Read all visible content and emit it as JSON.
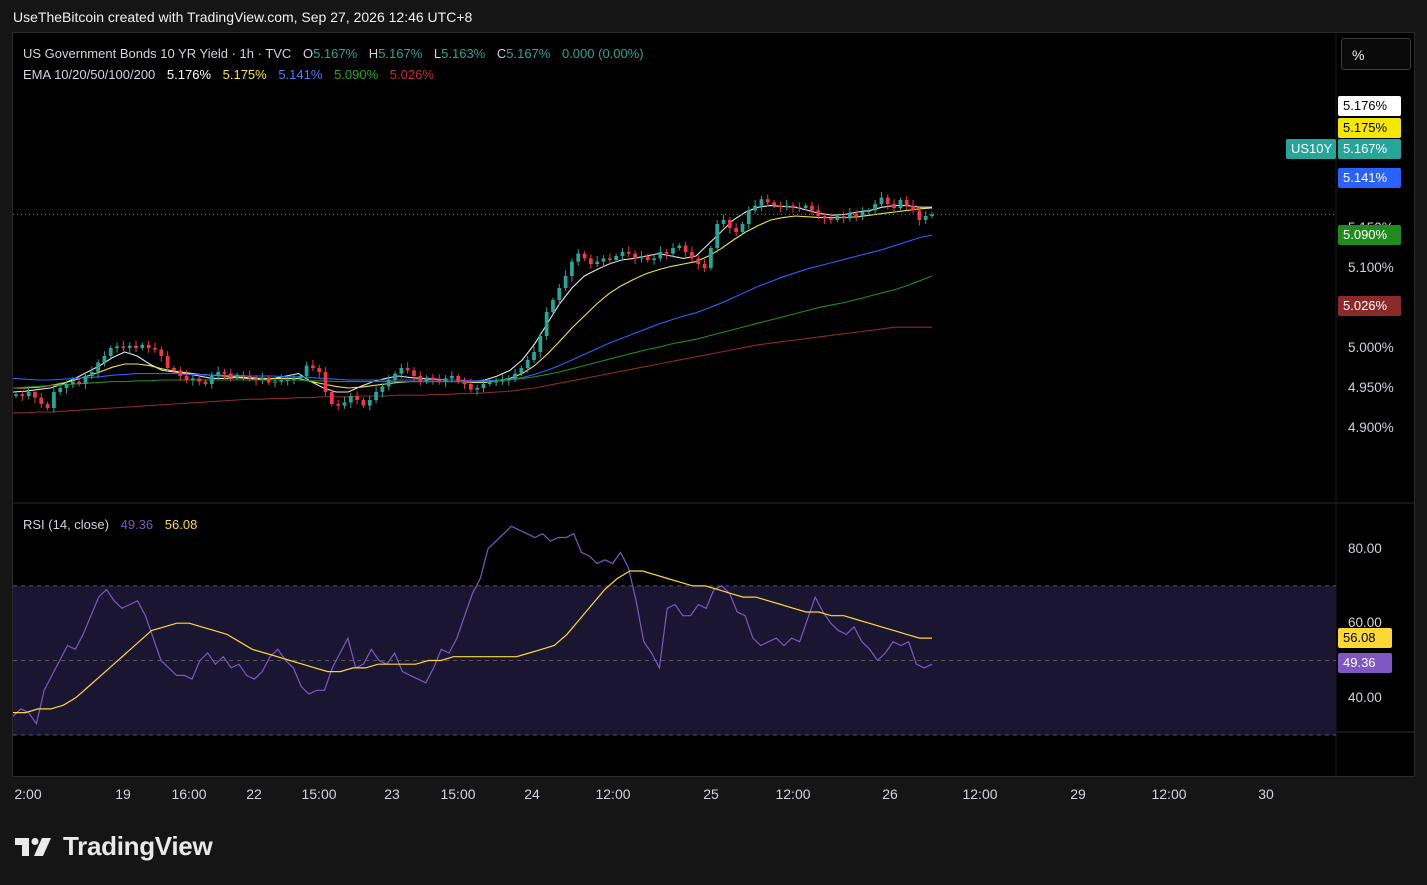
{
  "caption": "UseTheBitcoin created with TradingView.com, Sep 27, 2026 12:46 UTC+8",
  "legend": {
    "title": "US Government Bonds 10 YR Yield · 1h · TVC",
    "o_label": "O",
    "o_value": "5.167%",
    "h_label": "H",
    "h_value": "5.167%",
    "l_label": "L",
    "l_value": "5.163%",
    "c_label": "C",
    "c_value": "5.167%",
    "change": "0.000 (0.00%)",
    "ema_label": "EMA 10/20/50/100/200",
    "ema10": "5.176%",
    "ema20": "5.175%",
    "ema50": "5.141%",
    "ema100": "5.090%",
    "ema200": "5.026%"
  },
  "rsi_legend": {
    "label": "RSI (14, close)",
    "rsi": "49.36",
    "ma": "56.08"
  },
  "toolbar": {
    "percent_label": "%"
  },
  "symbol_tag": "US10Y",
  "brand": {
    "name": "TradingView",
    "icon": "tradingview-logo-icon"
  },
  "colors": {
    "up": "#26a69a",
    "down": "#f23645",
    "ema10": "#e6e6e6",
    "ema20": "#f5e342",
    "ema50": "#2962ff",
    "ema100": "#1e8c1e",
    "ema200": "#8b2a2a",
    "rsi": "#7e57c2",
    "rsi_ma": "#fdd835"
  },
  "chart_data": [
    {
      "type": "candlestick",
      "title": "US Government Bonds 10 YR Yield · 1h · TVC",
      "x_ticks": [
        "2:00",
        "19",
        "16:00",
        "22",
        "15:00",
        "23",
        "15:00",
        "24",
        "12:00",
        "25",
        "12:00",
        "26",
        "12:00",
        "29",
        "12:00",
        "30"
      ],
      "y_ticks": [
        "4.900%",
        "4.950%",
        "5.000%",
        "5.050%",
        "5.100%",
        "5.150%"
      ],
      "ylim": [
        4.875,
        5.25
      ],
      "last_close": "5.167%",
      "ema_labels": [
        "5.176%",
        "5.175%",
        "5.141%",
        "5.090%",
        "5.026%"
      ],
      "close": [
        4.942,
        4.94,
        4.945,
        4.938,
        4.93,
        4.925,
        4.945,
        4.95,
        4.955,
        4.958,
        4.955,
        4.965,
        4.97,
        4.982,
        4.99,
        5.0,
        5.002,
        5.0,
        5.003,
        5.0,
        5.004,
        5.0,
        4.998,
        4.99,
        4.975,
        4.972,
        4.965,
        4.96,
        4.962,
        4.958,
        4.955,
        4.965,
        4.97,
        4.968,
        4.963,
        4.966,
        4.965,
        4.962,
        4.96,
        4.963,
        4.957,
        4.958,
        4.96,
        4.96,
        4.962,
        4.965,
        4.978,
        4.975,
        4.97,
        4.945,
        4.93,
        4.928,
        4.932,
        4.94,
        4.935,
        4.928,
        4.935,
        4.945,
        4.952,
        4.96,
        4.968,
        4.975,
        4.972,
        4.965,
        4.958,
        4.963,
        4.96,
        4.958,
        4.962,
        4.965,
        4.958,
        4.955,
        4.948,
        4.95,
        4.955,
        4.958,
        4.958,
        4.96,
        4.962,
        4.968,
        4.975,
        4.985,
        4.995,
        5.015,
        5.045,
        5.06,
        5.075,
        5.09,
        5.108,
        5.118,
        5.112,
        5.105,
        5.108,
        5.112,
        5.11,
        5.115,
        5.12,
        5.118,
        5.112,
        5.115,
        5.11,
        5.112,
        5.12,
        5.118,
        5.125,
        5.128,
        5.12,
        5.112,
        5.105,
        5.1,
        5.125,
        5.155,
        5.16,
        5.15,
        5.145,
        5.155,
        5.172,
        5.178,
        5.186,
        5.182,
        5.178,
        5.176,
        5.178,
        5.176,
        5.175,
        5.178,
        5.172,
        5.165,
        5.162,
        5.16,
        5.165,
        5.162,
        5.168,
        5.165,
        5.17,
        5.172,
        5.18,
        5.188,
        5.18,
        5.175,
        5.185,
        5.178,
        5.172,
        5.16,
        5.165,
        5.167
      ],
      "ema_series": [
        {
          "name": "EMA 10",
          "values": [
            4.945,
            4.946,
            4.948,
            4.95,
            4.955,
            4.962,
            4.97,
            4.978,
            4.988,
            4.995,
            4.99,
            4.98,
            4.972,
            4.97,
            4.968,
            4.965,
            4.962,
            4.962,
            4.963,
            4.962,
            4.961,
            4.962,
            4.965,
            4.968,
            4.958,
            4.95,
            4.945,
            4.945,
            4.952,
            4.958,
            4.962,
            4.965,
            4.963,
            4.962,
            4.961,
            4.96,
            4.96,
            4.958,
            4.96,
            4.965,
            4.972,
            4.985,
            5.005,
            5.03,
            5.055,
            5.075,
            5.09,
            5.098,
            5.105,
            5.11,
            5.112,
            5.115,
            5.118,
            5.115,
            5.112,
            5.115,
            5.13,
            5.145,
            5.16,
            5.17,
            5.176,
            5.178,
            5.177,
            5.176,
            5.172,
            5.168,
            5.166,
            5.167,
            5.17,
            5.172,
            5.176,
            5.178,
            5.178,
            5.176,
            5.176
          ]
        },
        {
          "name": "EMA 20",
          "values": [
            4.95,
            4.95,
            4.951,
            4.953,
            4.956,
            4.96,
            4.965,
            4.97,
            4.976,
            4.98,
            4.98,
            4.978,
            4.974,
            4.971,
            4.969,
            4.967,
            4.966,
            4.965,
            4.964,
            4.963,
            4.962,
            4.962,
            4.962,
            4.962,
            4.958,
            4.955,
            4.952,
            4.95,
            4.951,
            4.953,
            4.955,
            4.957,
            4.958,
            4.958,
            4.958,
            4.958,
            4.958,
            4.957,
            4.957,
            4.959,
            4.962,
            4.968,
            4.978,
            4.992,
            5.008,
            5.025,
            5.04,
            5.055,
            5.068,
            5.078,
            5.086,
            5.093,
            5.098,
            5.102,
            5.105,
            5.108,
            5.115,
            5.124,
            5.135,
            5.145,
            5.153,
            5.16,
            5.163,
            5.165,
            5.164,
            5.163,
            5.163,
            5.163,
            5.164,
            5.166,
            5.168,
            5.17,
            5.172,
            5.174,
            5.175
          ]
        },
        {
          "name": "EMA 50",
          "values": [
            4.962,
            4.961,
            4.96,
            4.96,
            4.961,
            4.962,
            4.963,
            4.964,
            4.966,
            4.967,
            4.968,
            4.968,
            4.968,
            4.968,
            4.967,
            4.967,
            4.966,
            4.966,
            4.966,
            4.965,
            4.965,
            4.965,
            4.964,
            4.964,
            4.963,
            4.962,
            4.961,
            4.96,
            4.96,
            4.96,
            4.96,
            4.96,
            4.96,
            4.96,
            4.96,
            4.96,
            4.96,
            4.959,
            4.959,
            4.96,
            4.961,
            4.963,
            4.967,
            4.972,
            4.978,
            4.985,
            4.992,
            4.999,
            5.006,
            5.012,
            5.018,
            5.024,
            5.03,
            5.035,
            5.04,
            5.044,
            5.05,
            5.056,
            5.063,
            5.07,
            5.077,
            5.083,
            5.089,
            5.094,
            5.099,
            5.103,
            5.107,
            5.111,
            5.115,
            5.119,
            5.123,
            5.128,
            5.133,
            5.138,
            5.141
          ]
        },
        {
          "name": "EMA 100",
          "values": [
            4.95,
            4.951,
            4.952,
            4.953,
            4.954,
            4.955,
            4.956,
            4.957,
            4.958,
            4.958,
            4.959,
            4.959,
            4.96,
            4.96,
            4.96,
            4.96,
            4.96,
            4.96,
            4.96,
            4.96,
            4.96,
            4.96,
            4.96,
            4.96,
            4.959,
            4.959,
            4.958,
            4.958,
            4.958,
            4.958,
            4.958,
            4.958,
            4.958,
            4.958,
            4.958,
            4.958,
            4.958,
            4.958,
            4.958,
            4.959,
            4.96,
            4.962,
            4.964,
            4.967,
            4.97,
            4.974,
            4.978,
            4.982,
            4.986,
            4.99,
            4.994,
            4.998,
            5.001,
            5.005,
            5.008,
            5.011,
            5.015,
            5.019,
            5.023,
            5.027,
            5.031,
            5.035,
            5.039,
            5.043,
            5.047,
            5.051,
            5.054,
            5.057,
            5.061,
            5.065,
            5.069,
            5.073,
            5.078,
            5.084,
            5.09
          ]
        },
        {
          "name": "EMA 200",
          "values": [
            4.919,
            4.919,
            4.92,
            4.92,
            4.921,
            4.922,
            4.923,
            4.924,
            4.925,
            4.926,
            4.927,
            4.928,
            4.929,
            4.93,
            4.931,
            4.932,
            4.933,
            4.934,
            4.935,
            4.936,
            4.936,
            4.937,
            4.937,
            4.938,
            4.938,
            4.939,
            4.939,
            4.939,
            4.94,
            4.94,
            4.94,
            4.941,
            4.941,
            4.941,
            4.942,
            4.942,
            4.943,
            4.943,
            4.944,
            4.945,
            4.946,
            4.948,
            4.95,
            4.953,
            4.956,
            4.959,
            4.962,
            4.965,
            4.968,
            4.971,
            4.974,
            4.977,
            4.98,
            4.983,
            4.986,
            4.989,
            4.992,
            4.995,
            4.998,
            5.001,
            5.004,
            5.006,
            5.008,
            5.01,
            5.012,
            5.014,
            5.016,
            5.018,
            5.02,
            5.022,
            5.024,
            5.026,
            5.026,
            5.026,
            5.026
          ]
        }
      ]
    },
    {
      "type": "line",
      "title": "RSI (14, close)",
      "y_ticks": [
        "40.00",
        "60.00",
        "80.00"
      ],
      "ylim": [
        30,
        85
      ],
      "bands": [
        30,
        50,
        70
      ],
      "last_labels": [
        "56.08",
        "49.36"
      ],
      "series": [
        {
          "name": "RSI",
          "values": [
            35,
            37,
            36,
            33,
            42,
            46,
            50,
            54,
            53,
            57,
            62,
            67,
            69,
            66,
            64,
            65,
            66,
            62,
            56,
            50,
            48,
            46,
            46,
            45,
            50,
            52,
            49,
            51,
            48,
            49,
            46,
            45,
            47,
            51,
            53,
            50,
            48,
            43,
            41,
            42,
            42,
            48,
            52,
            56,
            48,
            49,
            53,
            50,
            49,
            52,
            47,
            46,
            45,
            44,
            48,
            53,
            52,
            56,
            62,
            68,
            72,
            80,
            82,
            84,
            86,
            85,
            84,
            83,
            84,
            82,
            83,
            83,
            84,
            79,
            78,
            76,
            77,
            76,
            79,
            75,
            66,
            55,
            52,
            48,
            64,
            65,
            62,
            62,
            65,
            64,
            69,
            70,
            68,
            63,
            62,
            56,
            54,
            55,
            56,
            54,
            56,
            55,
            61,
            67,
            63,
            60,
            58,
            57,
            59,
            55,
            53,
            50,
            52,
            55,
            54,
            55,
            49,
            48,
            49
          ]
        },
        {
          "name": "RSI MA",
          "values": [
            36,
            36,
            37,
            37,
            38,
            40,
            43,
            46,
            49,
            52,
            55,
            58,
            59,
            60,
            60,
            59,
            58,
            57,
            55,
            53,
            52,
            51,
            50,
            49,
            48,
            47,
            47,
            48,
            48,
            49,
            49,
            49,
            49,
            50,
            50,
            51,
            51,
            51,
            51,
            51,
            51,
            52,
            53,
            54,
            57,
            61,
            65,
            69,
            72,
            74,
            74,
            73,
            72,
            71,
            70,
            70,
            69,
            68,
            67,
            67,
            66,
            65,
            64,
            63,
            63,
            62,
            62,
            61,
            60,
            59,
            58,
            57,
            56,
            56
          ]
        }
      ]
    }
  ]
}
